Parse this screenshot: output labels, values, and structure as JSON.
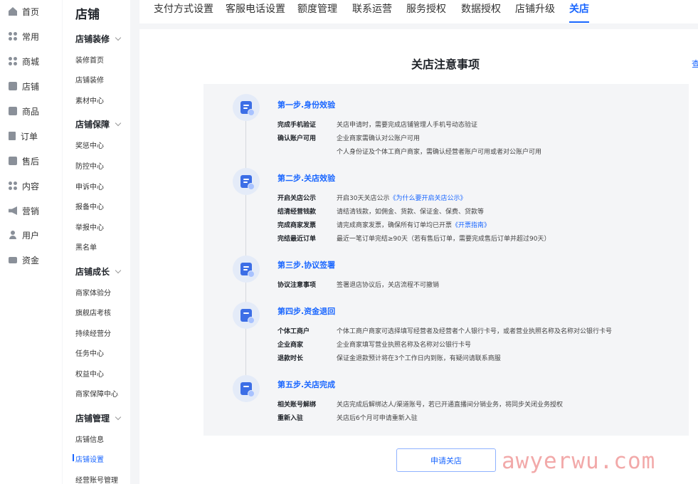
{
  "left_nav": [
    {
      "label": "首页",
      "icon": "home-icon"
    },
    {
      "label": "常用",
      "icon": "apps-icon"
    },
    {
      "label": "商城",
      "icon": "apps-icon"
    },
    {
      "label": "店铺",
      "icon": "shop-icon"
    },
    {
      "label": "商品",
      "icon": "product-icon"
    },
    {
      "label": "订单",
      "icon": "order-icon"
    },
    {
      "label": "售后",
      "icon": "aftersale-icon"
    },
    {
      "label": "内容",
      "icon": "apps-icon"
    },
    {
      "label": "营销",
      "icon": "speaker-icon"
    },
    {
      "label": "用户",
      "icon": "user-icon"
    },
    {
      "label": "资金",
      "icon": "wallet-icon"
    }
  ],
  "sub_nav": {
    "title": "店铺",
    "groups": [
      {
        "label": "店铺装修",
        "items": [
          "装修首页",
          "店铺装修",
          "素材中心"
        ]
      },
      {
        "label": "店铺保障",
        "items": [
          "奖惩中心",
          "防控中心",
          "申诉中心",
          "报备中心",
          "举报中心",
          "黑名单"
        ]
      },
      {
        "label": "店铺成长",
        "items": [
          "商家体验分",
          "旗舰店考核",
          "持续经营分",
          "任务中心",
          "权益中心",
          "商家保障中心"
        ]
      },
      {
        "label": "店铺管理",
        "items": [
          "店铺信息",
          "店铺设置",
          "经营账号管理"
        ]
      }
    ],
    "active_item": "店铺设置"
  },
  "tabs": [
    "支付方式设置",
    "客服电话设置",
    "额度管理",
    "联系运营",
    "服务授权",
    "数据授权",
    "店铺升级",
    "关店"
  ],
  "active_tab": "关店",
  "main": {
    "title": "关店注意事项",
    "side_link": "查",
    "steps": [
      {
        "title": "第一步.身份效验",
        "rows": [
          {
            "label": "完成手机验证",
            "text": "关店申请时，需要完成店铺管理人手机号动态验证"
          },
          {
            "label": "确认账户可用",
            "text": "企业商家需确认对公账户可用"
          },
          {
            "label": "",
            "text": "个人身份证及个体工商户商家，需确认经营者账户可用或者对公账户可用"
          }
        ]
      },
      {
        "title": "第二步.关店效验",
        "rows": [
          {
            "label": "开启关店公示",
            "text": "开启30天关店公示",
            "link": "《为什么要开启关店公示》"
          },
          {
            "label": "结清经营钱款",
            "text": "请结清钱款，如佣金、货款、保证金、保费、贷款等"
          },
          {
            "label": "完成商家发票",
            "text": "请完成商家发票，确保所有订单均已开票",
            "link": "《开票指南》"
          },
          {
            "label": "完结最近订单",
            "text": "最近一笔订单完结≥90天（若有售后订单，需要完成售后订单并超过90天）"
          }
        ]
      },
      {
        "title": "第三步.协议签署",
        "rows": [
          {
            "label": "协议注意事项",
            "text": "签署退店协议后，关店流程不可撤销"
          }
        ]
      },
      {
        "title": "第四步.资金退回",
        "rows": [
          {
            "label": "个体工商户",
            "text": "个体工商户商家可选择填写经营者及经营者个人银行卡号，或者营业执照名称及名称对公银行卡号"
          },
          {
            "label": "企业商家",
            "text": "企业商家填写营业执照名称及名称对公银行卡号"
          },
          {
            "label": "退款时长",
            "text": "保证金退款预计将在3个工作日内到账，有疑问请联系商服"
          }
        ]
      },
      {
        "title": "第五步.关店完成",
        "rows": [
          {
            "label": "相关账号解绑",
            "text": "关店完成后解绑达人/渠道账号，若已开通直播间分销业务，将同步关闭业务授权"
          },
          {
            "label": "重新入驻",
            "text": "关店后6个月可申请重新入驻"
          }
        ]
      }
    ],
    "apply_button": "申请关店"
  },
  "watermark": "awyerwu.com"
}
